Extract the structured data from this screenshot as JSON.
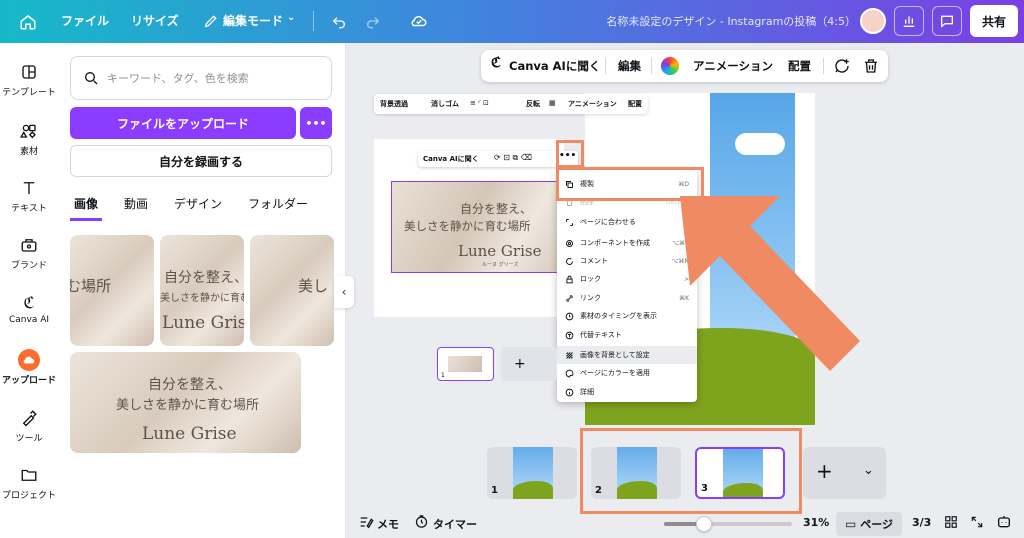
{
  "topbar": {
    "file_label": "ファイル",
    "resize_label": "リサイズ",
    "edit_mode_label": "編集モード",
    "document_title": "名称未設定のデザイン - Instagramの投稿（4:5）",
    "share_label": "共有"
  },
  "rail": {
    "items": [
      {
        "label": "テンプレート",
        "icon": "template-icon"
      },
      {
        "label": "素材",
        "icon": "elements-icon"
      },
      {
        "label": "テキスト",
        "icon": "text-icon"
      },
      {
        "label": "ブランド",
        "icon": "brand-icon"
      },
      {
        "label": "Canva AI",
        "icon": "canva-ai-icon"
      },
      {
        "label": "アップロード",
        "icon": "upload-icon"
      },
      {
        "label": "ツール",
        "icon": "tools-icon"
      },
      {
        "label": "プロジェクト",
        "icon": "folder-icon"
      }
    ]
  },
  "panel": {
    "search_placeholder": "キーワード、タグ、色を検索",
    "upload_button": "ファイルをアップロード",
    "more_button": "•••",
    "record_button": "自分を録画する",
    "tabs": [
      "画像",
      "動画",
      "デザイン",
      "フォルダー"
    ],
    "thumb_text": {
      "a": "む場所",
      "b1": "自分を整え、",
      "b2": "美しさを静かに育む",
      "b3": "Lune Grise",
      "c": "美し",
      "big1": "自分を整え、",
      "big2": "美しさを静かに育む場所",
      "big3": "Lune Grise"
    }
  },
  "context_toolbar": {
    "canva_ai": "Canva AIに聞く",
    "edit": "編集",
    "animation": "アニメーション",
    "arrange": "配置"
  },
  "screenshot": {
    "toolbar": [
      "背景透過",
      "消しゴム",
      "反転",
      "アニメーション",
      "配置"
    ],
    "ctx_label": "Canva AIに聞く",
    "banner_line1": "自分を整え、",
    "banner_line2": "美しさを静かに育む場所",
    "banner_brand": "Lune Grise",
    "banner_sub": "ルーヌ グリーズ",
    "menu": [
      {
        "label": "複製",
        "shortcut": "⌘D"
      },
      {
        "label": "削除",
        "shortcut": "DELETE"
      },
      {
        "label": "ページに合わせる",
        "shortcut": ">"
      },
      {
        "label": "コンポーネントを作成",
        "shortcut": "⌥⌘K"
      },
      {
        "label": "コメント",
        "shortcut": "⌥⌘N"
      },
      {
        "label": "ロック",
        "shortcut": ">"
      },
      {
        "label": "リンク",
        "shortcut": "⌘K"
      },
      {
        "label": "素材のタイミングを表示",
        "shortcut": ""
      },
      {
        "label": "代替テキスト",
        "shortcut": ""
      },
      {
        "label": "画像を背景として設定",
        "shortcut": ""
      },
      {
        "label": "ページにカラーを適用",
        "shortcut": ""
      },
      {
        "label": "詳細",
        "shortcut": ""
      }
    ],
    "page_num": "1",
    "add_symbol": "+"
  },
  "pages": [
    {
      "number": "1"
    },
    {
      "number": "2"
    },
    {
      "number": "3"
    }
  ],
  "footer": {
    "notes": "メモ",
    "timer": "タイマー",
    "zoom": "31%",
    "zoom_fraction": 0.31,
    "page_view": "ページ",
    "page_count": "3/3"
  },
  "colors": {
    "accent": "#8b3dff",
    "highlight": "#ef8a63",
    "upload_active": "#ff6b2c"
  }
}
